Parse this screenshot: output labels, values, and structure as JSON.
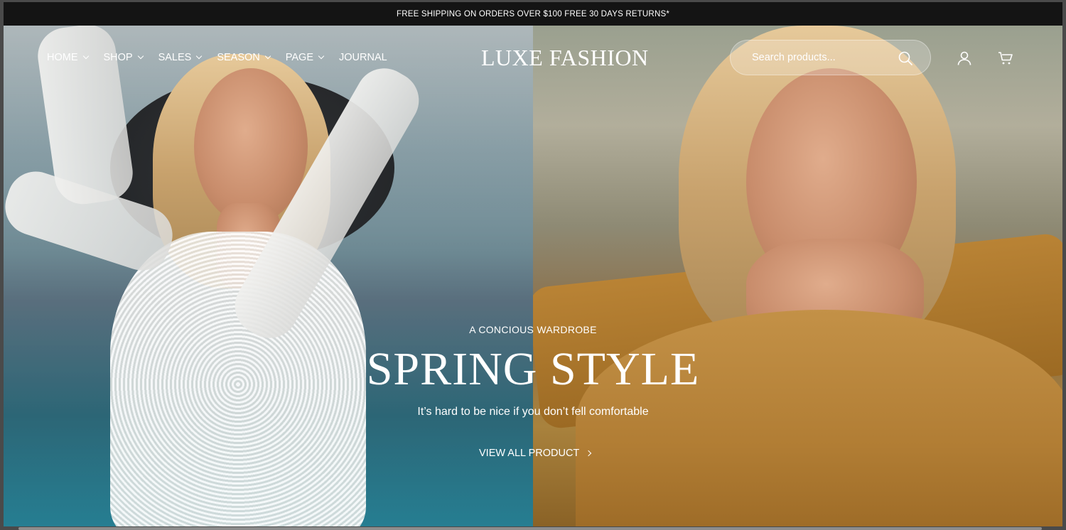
{
  "announcement": "FREE SHIPPING ON ORDERS OVER $100 FREE 30 DAYS RETURNS*",
  "nav": {
    "items": [
      {
        "label": "HOME",
        "dropdown": true
      },
      {
        "label": "SHOP",
        "dropdown": true
      },
      {
        "label": "SALES",
        "dropdown": true
      },
      {
        "label": "SEASON",
        "dropdown": true
      },
      {
        "label": "PAGE",
        "dropdown": true
      },
      {
        "label": "JOURNAL",
        "dropdown": false
      }
    ]
  },
  "logo": "LUXE FASHION",
  "search": {
    "placeholder": "Search products..."
  },
  "icons": {
    "search": "search-icon",
    "user": "user-icon",
    "cart": "cart-icon"
  },
  "hero": {
    "eyebrow": "A CONCIOUS WARDROBE",
    "headline": "SPRING STYLE",
    "subline": "It’s hard to be nice if you don’t fell comfortable",
    "cta": "VIEW ALL PRODUCT"
  },
  "colors": {
    "announce_bg": "#141414",
    "text": "#ffffff"
  }
}
